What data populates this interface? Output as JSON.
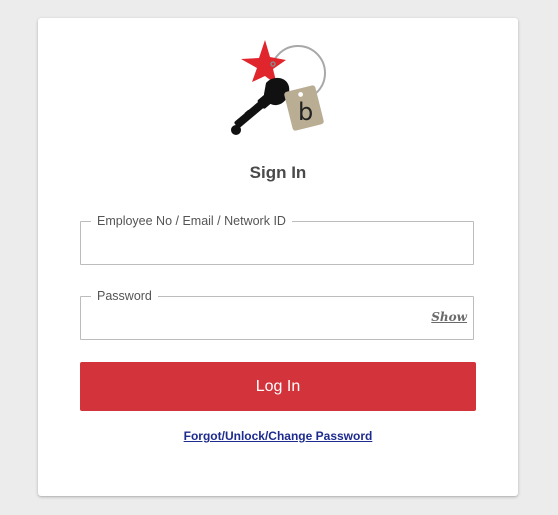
{
  "logo": {
    "icon": "key-ring-logo-icon",
    "tag_letter": "b",
    "colors": {
      "star": "#e0252c",
      "key": "#111111",
      "tag": "#b9ad93",
      "ring": "#a8a8a8"
    }
  },
  "form": {
    "title": "Sign In",
    "user_label": "Employee No / Email / Network ID",
    "user_value": "",
    "password_label": "Password",
    "password_value": "",
    "show_label": "Show",
    "login_label": "Log In",
    "forgot_label": "Forgot/Unlock/Change Password"
  },
  "colors": {
    "primary_button": "#d3343b",
    "link": "#1d2b8f",
    "background": "#ececec"
  }
}
